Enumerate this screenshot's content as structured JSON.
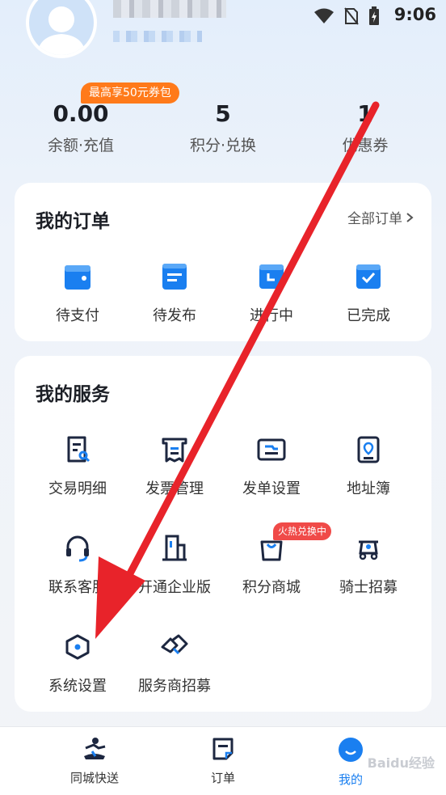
{
  "status_bar": {
    "time": "9:06",
    "icons": [
      "wifi-icon",
      "no-sim-icon",
      "battery-charging-icon"
    ]
  },
  "profile": {
    "promo_badge": "最高享50元券包"
  },
  "stats": [
    {
      "value": "0.00",
      "label": "余额·充值"
    },
    {
      "value": "5",
      "label": "积分·兑换"
    },
    {
      "value": "1",
      "label": "优惠券"
    }
  ],
  "orders": {
    "title": "我的订单",
    "all_link": "全部订单",
    "items": [
      {
        "label": "待支付",
        "icon": "wallet-icon"
      },
      {
        "label": "待发布",
        "icon": "document-icon"
      },
      {
        "label": "进行中",
        "icon": "clock-icon"
      },
      {
        "label": "已完成",
        "icon": "check-icon"
      }
    ]
  },
  "services": {
    "title": "我的服务",
    "hot_badge": "火热兑换中",
    "items": [
      {
        "label": "交易明细",
        "icon": "receipt-search-icon"
      },
      {
        "label": "发票管理",
        "icon": "invoice-icon"
      },
      {
        "label": "发单设置",
        "icon": "order-settings-icon"
      },
      {
        "label": "地址簿",
        "icon": "address-book-icon"
      },
      {
        "label": "联系客服",
        "icon": "headset-icon"
      },
      {
        "label": "开通企业版",
        "icon": "building-icon"
      },
      {
        "label": "积分商城",
        "icon": "shopping-bag-icon"
      },
      {
        "label": "骑士招募",
        "icon": "scooter-icon"
      },
      {
        "label": "系统设置",
        "icon": "settings-hexagon-icon"
      },
      {
        "label": "服务商招募",
        "icon": "handshake-icon"
      }
    ]
  },
  "bottom_nav": [
    {
      "label": "同城快送",
      "icon": "courier-icon"
    },
    {
      "label": "订单",
      "icon": "order-icon"
    },
    {
      "label": "我的",
      "icon": "profile-smile-icon",
      "active": true
    }
  ],
  "watermark": "Baidu经验",
  "colors": {
    "accent": "#1a7ff0",
    "promo": "#ff7a1a",
    "hot": "#f04a48",
    "annotation_arrow": "#e8232a"
  }
}
